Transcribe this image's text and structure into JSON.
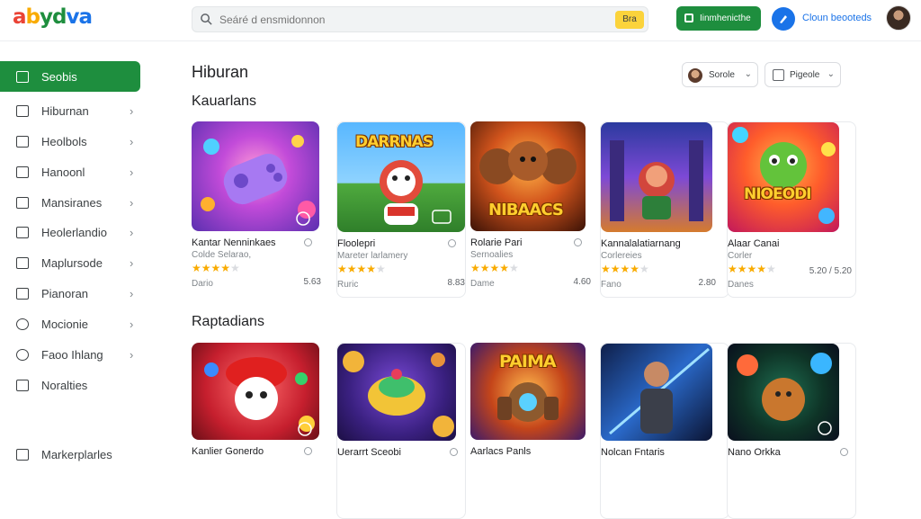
{
  "header": {
    "logo_parts": [
      "a",
      "b",
      "yd",
      "va"
    ],
    "search_placeholder": "Seáré d ensmidonnon",
    "search_button": "Bra",
    "install_button": "Iinmhenicthe",
    "help_label": "Cloun beooteds"
  },
  "sidebar": {
    "items": [
      {
        "label": "Seobis",
        "active": true,
        "icon": "store-icon"
      },
      {
        "label": "Hiburnan",
        "active": false,
        "icon": "bookmark-icon"
      },
      {
        "label": "Heolbols",
        "active": false,
        "icon": "image-icon"
      },
      {
        "label": "Hanoonl",
        "active": false,
        "icon": "doc-icon"
      },
      {
        "label": "Mansiranes",
        "active": false,
        "icon": "home-icon"
      },
      {
        "label": "Heolerlandio",
        "active": false,
        "icon": "list-icon"
      },
      {
        "label": "Maplursode",
        "active": false,
        "icon": "gift-icon"
      },
      {
        "label": "Pianoran",
        "active": false,
        "icon": "person-icon"
      },
      {
        "label": "Mocionie",
        "active": false,
        "icon": "compass-icon"
      },
      {
        "label": "Faoo Ihlang",
        "active": false,
        "icon": "settings-icon"
      },
      {
        "label": "Noralties",
        "active": false,
        "icon": "notes-icon"
      },
      {
        "label": "Markerplarles",
        "active": false,
        "icon": "market-icon"
      }
    ]
  },
  "main": {
    "title": "Hiburan",
    "filters": {
      "sort_label": "Sorole",
      "check_label": "Pigeole"
    },
    "sections": [
      {
        "title": "Kauarlans",
        "cards": [
          {
            "name": "Kantar Nenninkaes",
            "publisher": "Colde Selarao,",
            "stars": 4,
            "price": "Dario",
            "size": "5.63"
          },
          {
            "name": "Floolepri",
            "publisher": "Mareter larlamery",
            "stars": 4,
            "price": "Ruric",
            "size": "8.83"
          },
          {
            "name": "Rolarie Pari",
            "publisher": "Sernoalies",
            "stars": 4,
            "price": "Dame",
            "size": "4.60"
          },
          {
            "name": "Kannalalatiarnang",
            "publisher": "Corlereies",
            "stars": 4,
            "price": "Fano",
            "size": "2.80"
          },
          {
            "name": "Alaar Canai",
            "publisher": "Corler",
            "stars": 4,
            "price": "Danes",
            "size": "5.20 / 5.20"
          }
        ]
      },
      {
        "title": "Raptadians",
        "cards": [
          {
            "name": "Kanlier Gonerdo"
          },
          {
            "name": "Uerarrt Sceobi"
          },
          {
            "name": "Aarlacs Panls"
          },
          {
            "name": "Nolcan Fntaris"
          },
          {
            "name": "Nano Orkka"
          }
        ]
      }
    ],
    "thumb_texts": [
      "DARRNAS",
      "NIBAACS",
      "NIOEODI",
      "PAIMA"
    ]
  }
}
